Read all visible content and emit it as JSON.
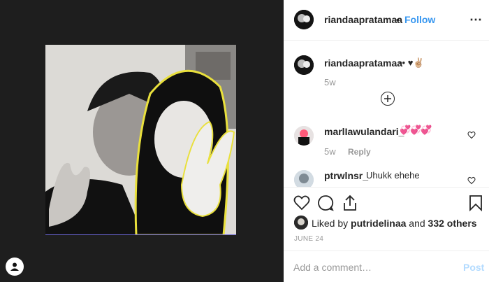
{
  "post": {
    "username": "riandaapratamaa",
    "separator": "•",
    "follow_label": "Follow",
    "more_icon": "more-options-icon",
    "caption": {
      "username": "riandaapratamaa",
      "text": "•• ♥✌🏼",
      "age": "5w"
    },
    "load_more_icon": "plus-circle-icon",
    "comments": [
      {
        "username": "marlIawulandari_",
        "text": "💞💞💞",
        "age": "5w",
        "reply_label": "Reply"
      },
      {
        "username": "ptrwlnsr_",
        "text": "Uhukk ehehe"
      }
    ],
    "likes": {
      "prefix": "Liked by",
      "user": "putridelinaa",
      "middle": "and",
      "others": "332 others"
    },
    "date": "JUNE 24",
    "add_comment_placeholder": "Add a comment…",
    "post_label": "Post"
  },
  "colors": {
    "accent": "#3897f0",
    "post_disabled": "#b3dbff",
    "media_bg": "#1e1e1e",
    "muted": "#999999"
  }
}
